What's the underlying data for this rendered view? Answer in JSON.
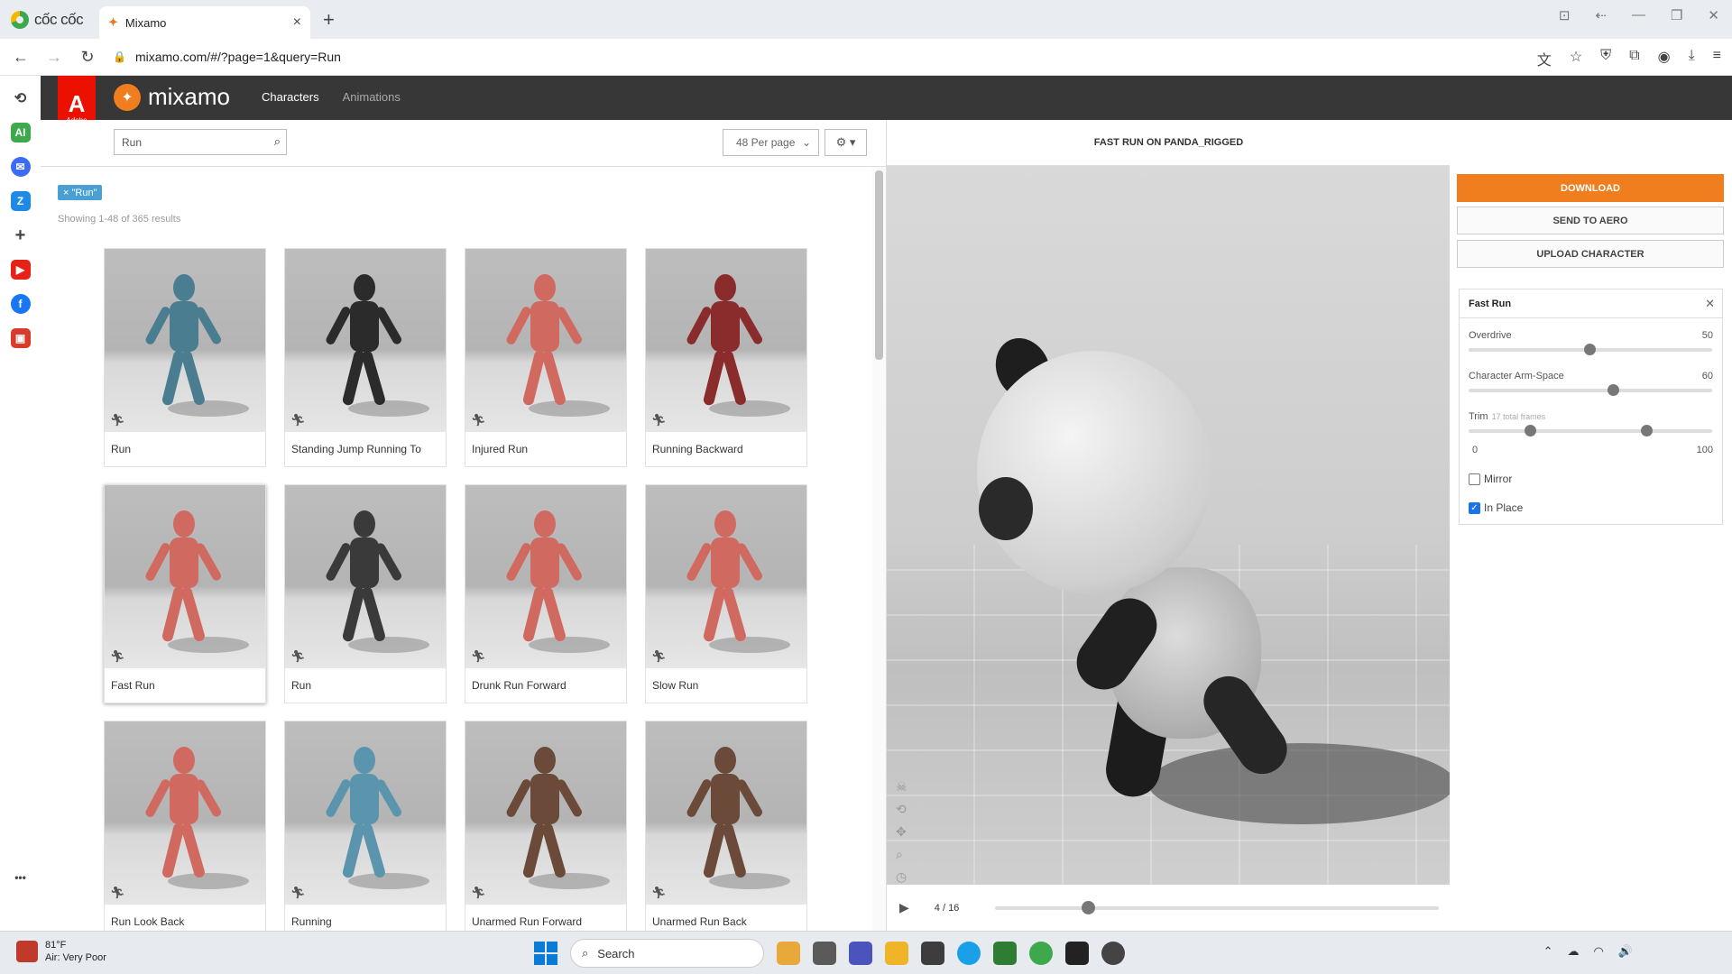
{
  "browser": {
    "brand": "cốc cốc",
    "tab_title": "Mixamo",
    "url": "mixamo.com/#/?page=1&query=Run"
  },
  "header": {
    "adobe_label": "Adobe",
    "logo_text": "mixamo",
    "nav": [
      "Characters",
      "Animations"
    ]
  },
  "search": {
    "value": "Run",
    "per_page": "48 Per page"
  },
  "filter_tag": "× \"Run\"",
  "results_text": "Showing 1-48 of 365 results",
  "cards": [
    {
      "label": "Run",
      "color": "#4a7d8f"
    },
    {
      "label": "Standing Jump Running To",
      "color": "#2b2b2b"
    },
    {
      "label": "Injured Run",
      "color": "#d06a60"
    },
    {
      "label": "Running Backward",
      "color": "#8b2c2c"
    },
    {
      "label": "Fast Run",
      "color": "#d06a60"
    },
    {
      "label": "Run",
      "color": "#3a3a3a"
    },
    {
      "label": "Drunk Run Forward",
      "color": "#d06a60"
    },
    {
      "label": "Slow Run",
      "color": "#d06a60"
    },
    {
      "label": "Run Look Back",
      "color": "#d06a60"
    },
    {
      "label": "Running",
      "color": "#5a95ad"
    },
    {
      "label": "Unarmed Run Forward",
      "color": "#6b4a3a"
    },
    {
      "label": "Unarmed Run Back",
      "color": "#6b4a3a"
    }
  ],
  "viewer": {
    "title": "FAST RUN ON PANDA_RIGGED",
    "frame": "4 / 16",
    "progress": 0.21
  },
  "actions": {
    "download": "DOWNLOAD",
    "aero": "SEND TO AERO",
    "upload": "UPLOAD CHARACTER"
  },
  "settings": {
    "title": "Fast Run",
    "overdrive_label": "Overdrive",
    "overdrive_value": "50",
    "arm_label": "Character Arm-Space",
    "arm_value": "60",
    "trim_label": "Trim",
    "trim_sub": "17 total frames",
    "trim_min": "0",
    "trim_max": "100",
    "mirror_label": "Mirror",
    "inplace_label": "In Place"
  },
  "taskbar": {
    "temp": "81°F",
    "air": "Air: Very Poor",
    "search": "Search"
  },
  "colors": {
    "accent": "#f07d1e",
    "adobe": "#eb1000",
    "header": "#373737"
  }
}
